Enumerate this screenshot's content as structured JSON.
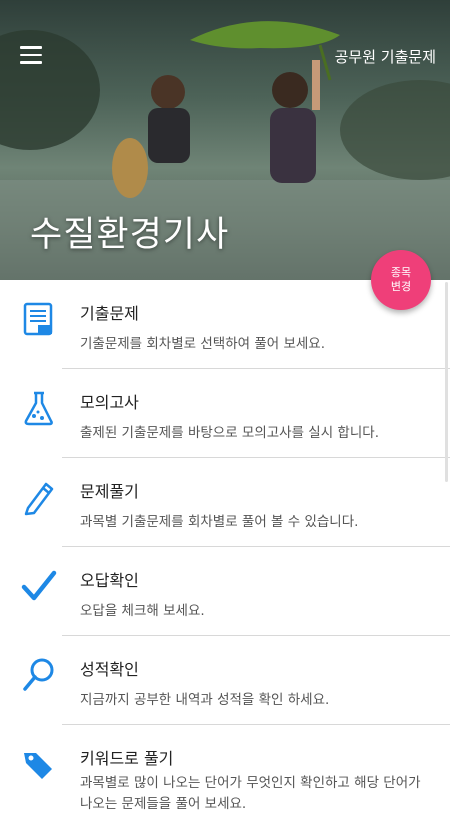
{
  "header": {
    "app_title": "공무원 기출문제",
    "hero_title": "수질환경기사",
    "fab_label": "종목 변경"
  },
  "menu": [
    {
      "title": "기출문제",
      "desc": "기출문제를 회차별로 선택하여 풀어 보세요.",
      "icon": "document-list-icon"
    },
    {
      "title": "모의고사",
      "desc": "출제된 기출문제를 바탕으로 모의고사를 실시 합니다.",
      "icon": "flask-icon"
    },
    {
      "title": "문제풀기",
      "desc": "과목별 기출문제를 회차별로 풀어 볼 수 있습니다.",
      "icon": "pencil-icon"
    },
    {
      "title": "오답확인",
      "desc": "오답을 체크해 보세요.",
      "icon": "checkmark-icon"
    },
    {
      "title": "성적확인",
      "desc": "지금까지 공부한 내역과 성적을 확인 하세요.",
      "icon": "magnifier-icon"
    },
    {
      "title": "키워드로 풀기",
      "desc": "과목별로 많이 나오는 단어가 무엇인지 확인하고 해당 단어가 나오는 문제들을 풀어 보세요.",
      "icon": "tag-icon"
    }
  ],
  "colors": {
    "accent": "#ef3f79",
    "icon_blue": "#1e88e5"
  }
}
